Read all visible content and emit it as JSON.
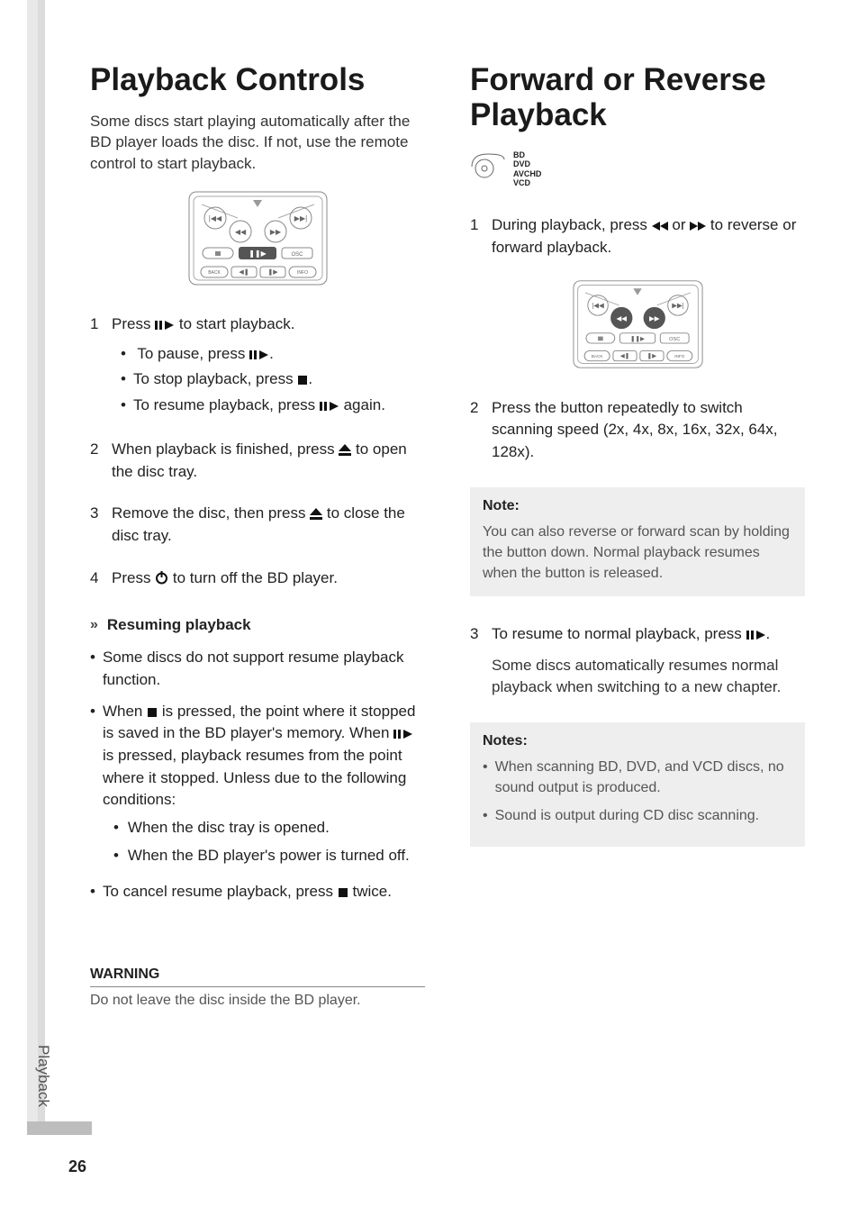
{
  "sideTab": "Playback",
  "pageNumber": "26",
  "left": {
    "title": "Playback Controls",
    "intro": "Some discs start playing automatically after the BD player loads the disc. If not, use the remote control to start playback.",
    "steps": [
      {
        "n": "1",
        "preIcon": "Press ",
        "icon": "play-pause-icon",
        "postIcon": " to start playback.",
        "sub": [
          {
            "pre": " To pause, press ",
            "icon": "play-pause-icon",
            "post": "."
          },
          {
            "pre": "To stop playback, press ",
            "icon": "stop-icon",
            "post": "."
          },
          {
            "pre": "To resume playback, press ",
            "icon": "play-pause-icon",
            "post": " again."
          }
        ]
      },
      {
        "n": "2",
        "preIcon": "When playback is finished, press ",
        "icon": "eject-icon",
        "postIcon": " to open the disc tray."
      },
      {
        "n": "3",
        "preIcon": "Remove the disc, then press ",
        "icon": "eject-icon",
        "postIcon": " to close the disc tray."
      },
      {
        "n": "4",
        "preIcon": "Press ",
        "icon": "power-icon",
        "postIcon": " to turn off the BD player."
      }
    ],
    "resume": {
      "heading": "Resuming playback",
      "bullets": [
        {
          "plain": "Some discs do not support resume playback function."
        },
        {
          "segments": [
            {
              "t": "When "
            },
            {
              "icon": "stop-icon"
            },
            {
              "t": " is pressed, the point where it stopped is saved in the BD player's memory. When "
            },
            {
              "icon": "play-pause-icon"
            },
            {
              "t": " is pressed, playback resumes from the point where it stopped. Unless due to the following conditions:"
            }
          ],
          "sub": [
            "When the disc tray is opened.",
            "When the BD player's power is turned off."
          ]
        },
        {
          "segments": [
            {
              "t": "To cancel resume playback, press "
            },
            {
              "icon": "stop-icon"
            },
            {
              "t": " twice."
            }
          ]
        }
      ]
    },
    "warning": {
      "heading": "WARNING",
      "body": "Do not leave the disc inside the BD player."
    }
  },
  "right": {
    "title": "Forward or Reverse Playback",
    "discTypes": [
      "BD",
      "DVD",
      "AVCHD",
      "VCD"
    ],
    "steps12": [
      {
        "n": "1",
        "segments": [
          {
            "t": "During playback, press "
          },
          {
            "icon": "rewind-icon"
          },
          {
            "t": " or "
          },
          {
            "icon": "fastforward-icon"
          },
          {
            "t": " to reverse or forward playback."
          }
        ]
      },
      {
        "n": "2",
        "plain": "Press the button repeatedly to switch scanning  speed (2x, 4x, 8x, 16x, 32x, 64x, 128x)."
      }
    ],
    "note1": {
      "heading": "Note:",
      "body": "You can also reverse or forward scan by holding the button down. Normal playback resumes when the button is released."
    },
    "step3": {
      "n": "3",
      "segments": [
        {
          "t": "To resume to normal playback, press "
        },
        {
          "icon": "play-pause-icon"
        },
        {
          "t": "."
        }
      ],
      "para": "Some discs automatically resumes normal playback when switching to a new chapter."
    },
    "note2": {
      "heading": "Notes:",
      "items": [
        "When scanning BD, DVD, and VCD discs, no sound output is produced.",
        "Sound is output during CD disc scanning."
      ]
    }
  },
  "icons": {
    "play-pause-icon": "❚❚▶",
    "stop-icon": "■",
    "eject-icon": "eject",
    "power-icon": "power",
    "rewind-icon": "rew",
    "fastforward-icon": "ffw"
  },
  "remoteLabels": {
    "osc": "OSC",
    "back": "BACK",
    "info": "INFO"
  }
}
